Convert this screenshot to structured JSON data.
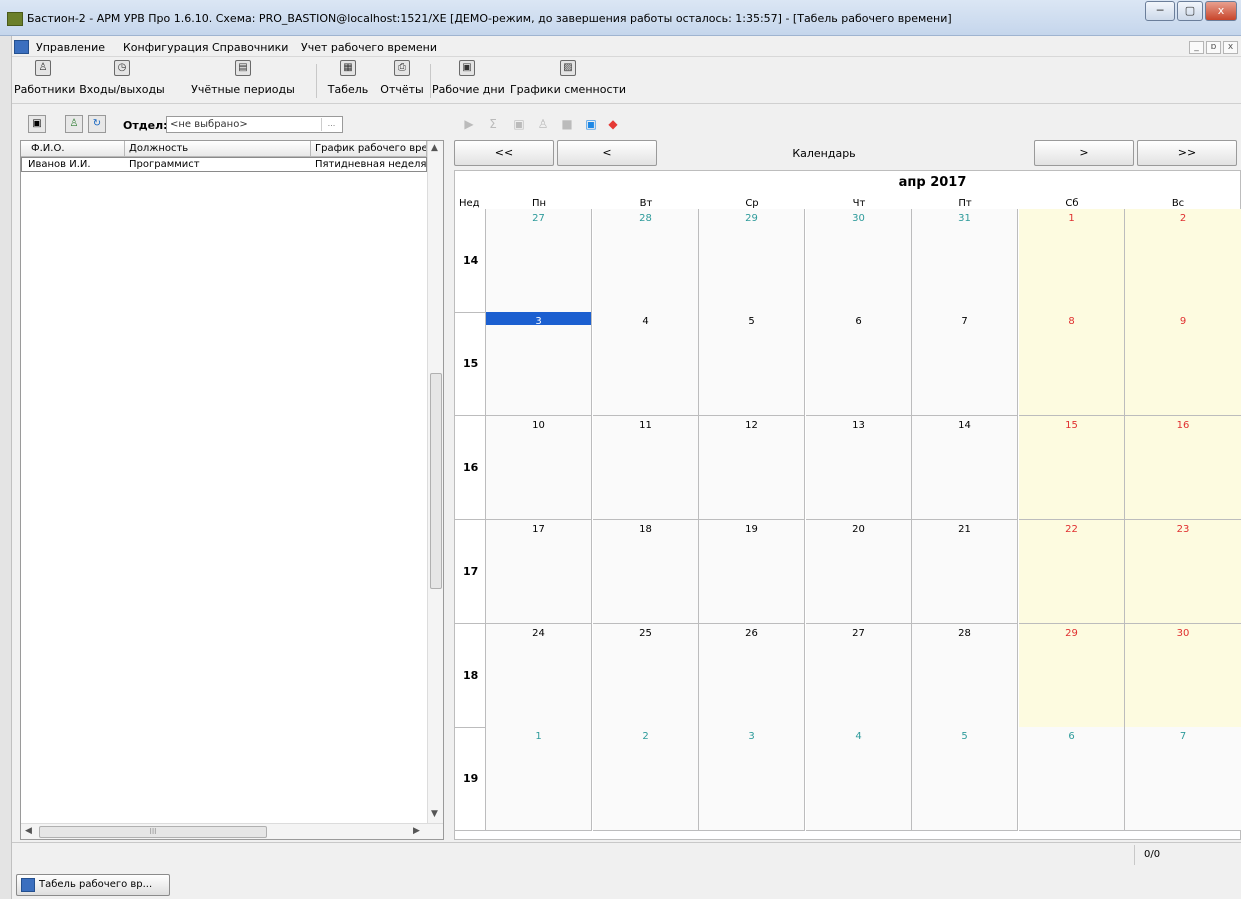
{
  "window": {
    "title": "Бастион-2 - АРМ УРВ Про 1.6.10. Схема: PRO_BASTION@localhost:1521/XE [ДЕМО-режим, до завершения работы осталось: 1:35:57] - [Табель рабочего времени]",
    "minimize": "─",
    "maximize": "▢",
    "close": "x"
  },
  "menu": {
    "items": [
      "Управление",
      "Конфигурация",
      "Справочники",
      "Учет рабочего времени"
    ],
    "mdi_min": "_",
    "mdi_restore": "ɒ",
    "mdi_close": "x"
  },
  "toolbar": {
    "buttons": [
      {
        "label": "Работники",
        "icon": "workers-icon",
        "glyph": "♙"
      },
      {
        "label": "Входы/выходы",
        "icon": "clock-icon",
        "glyph": "◷"
      },
      {
        "label": "Учётные периоды",
        "icon": "calendar-periods-icon",
        "glyph": "▤"
      },
      {
        "label": "Табель",
        "icon": "timesheet-icon",
        "glyph": "▦"
      },
      {
        "label": "Отчёты",
        "icon": "printer-icon",
        "glyph": "⎙"
      },
      {
        "label": "Рабочие дни",
        "icon": "workdays-icon",
        "glyph": "▣"
      },
      {
        "label": "Графики сменности",
        "icon": "chart-icon",
        "glyph": "▨"
      }
    ]
  },
  "left_panel": {
    "dept_label": "Отдел:",
    "dept_value": "<не выбрано>",
    "dept_dots": "...",
    "columns": [
      "Ф.И.О.",
      "Должность",
      "График рабочего вре"
    ],
    "rows": [
      [
        "Иванов И.И.",
        "Программист",
        "Пятидневная неделя"
      ]
    ],
    "hthumb": "III"
  },
  "calendar": {
    "nav": {
      "first": "<<",
      "prev": "<",
      "caption": "Календарь",
      "next": ">",
      "last": ">>"
    },
    "month": "апр 2017",
    "week_header": "Нед",
    "days": [
      "Пн",
      "Вт",
      "Ср",
      "Чт",
      "Пт",
      "Сб",
      "Вс"
    ],
    "weeks": [
      {
        "num": "14",
        "dates": [
          "27",
          "28",
          "29",
          "30",
          "31",
          "1",
          "2"
        ]
      },
      {
        "num": "15",
        "dates": [
          "3",
          "4",
          "5",
          "6",
          "7",
          "8",
          "9"
        ]
      },
      {
        "num": "16",
        "dates": [
          "10",
          "11",
          "12",
          "13",
          "14",
          "15",
          "16"
        ]
      },
      {
        "num": "17",
        "dates": [
          "17",
          "18",
          "19",
          "20",
          "21",
          "22",
          "23"
        ]
      },
      {
        "num": "18",
        "dates": [
          "24",
          "25",
          "26",
          "27",
          "28",
          "29",
          "30"
        ]
      },
      {
        "num": "19",
        "dates": [
          "1",
          "2",
          "3",
          "4",
          "5",
          "6",
          "7"
        ]
      }
    ],
    "selected_date": "3",
    "colors": {
      "other_month": "#2e9b9b",
      "weekend": "#e03030",
      "weekend_bg": "#fdfbe0",
      "selected": "#1b5fd0"
    }
  },
  "status": {
    "counter": "0/0"
  },
  "taskbar": {
    "window_label": "Табель рабочего вр..."
  }
}
